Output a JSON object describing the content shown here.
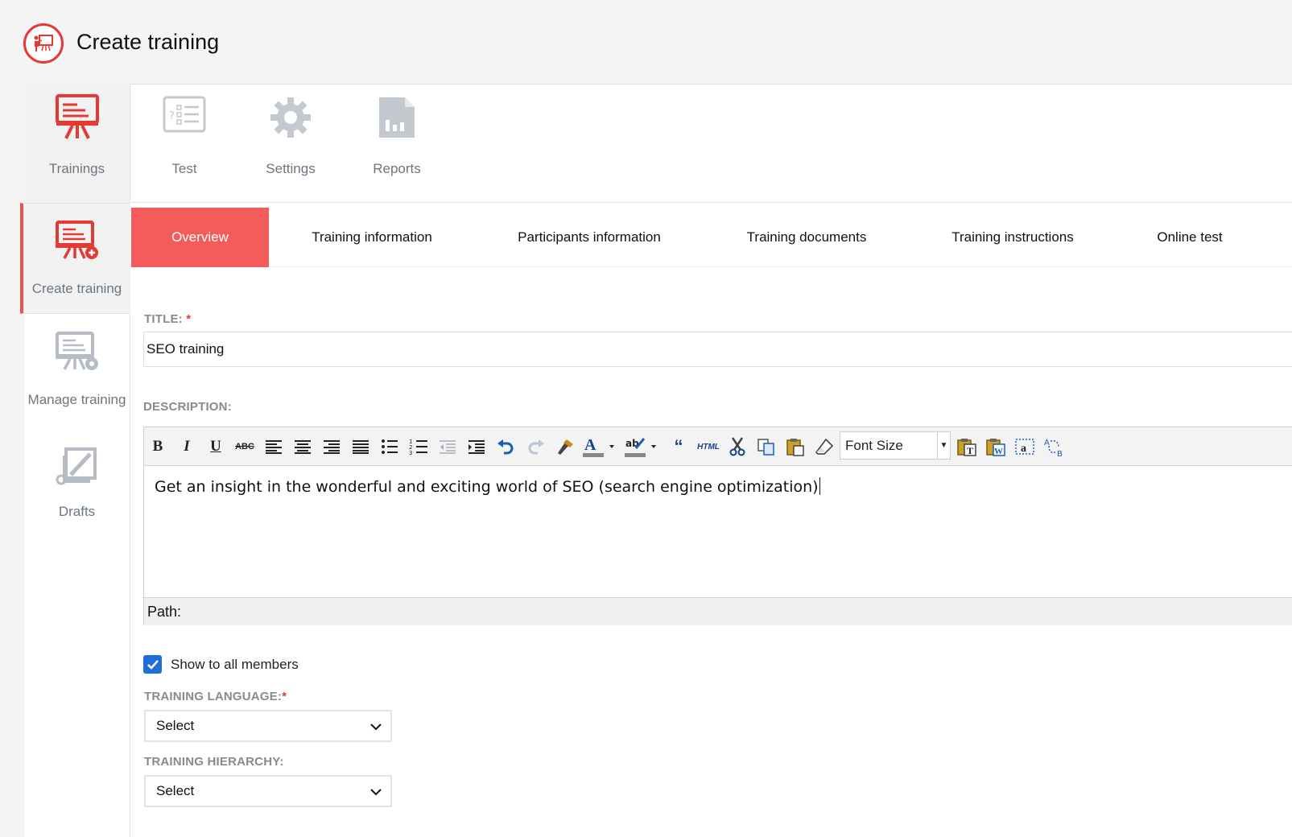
{
  "header": {
    "title": "Create training"
  },
  "sidebar": {
    "items": [
      {
        "label": "Trainings",
        "icon": "presentation-board-icon"
      },
      {
        "label": "Create training",
        "icon": "presentation-add-icon"
      },
      {
        "label": "Manage training",
        "icon": "presentation-settings-icon"
      },
      {
        "label": "Drafts",
        "icon": "drafts-edit-icon"
      }
    ]
  },
  "topnav": {
    "items": [
      {
        "label": "Test",
        "icon": "test-list-icon"
      },
      {
        "label": "Settings",
        "icon": "gear-icon"
      },
      {
        "label": "Reports",
        "icon": "report-chart-icon"
      }
    ]
  },
  "tabs": [
    {
      "label": "Overview",
      "active": true
    },
    {
      "label": "Training information"
    },
    {
      "label": "Participants information"
    },
    {
      "label": "Training documents"
    },
    {
      "label": "Training instructions"
    },
    {
      "label": "Online test"
    }
  ],
  "form": {
    "title_label": "TITLE:",
    "title_value": "SEO training",
    "description_label": "DESCRIPTION:",
    "description_text": "Get an insight in the wonderful and exciting world of SEO (search engine optimization)",
    "font_size_label": "Font Size",
    "path_label": "Path:",
    "show_all_label": "Show to all members",
    "show_all_checked": true,
    "language_label": "TRAINING LANGUAGE:",
    "language_value": "Select",
    "hierarchy_label": "TRAINING HIERARCHY:",
    "hierarchy_value": "Select",
    "required_mark": "*"
  },
  "toolbar": {
    "bold": "B",
    "italic": "I",
    "underline": "U",
    "strike": "ABC",
    "html": "HTML",
    "quote": "66"
  },
  "colors": {
    "accent": "#f45b5b",
    "brand_red": "#e53935",
    "checkbox": "#1e6fd9",
    "muted_text": "#6b7680"
  }
}
